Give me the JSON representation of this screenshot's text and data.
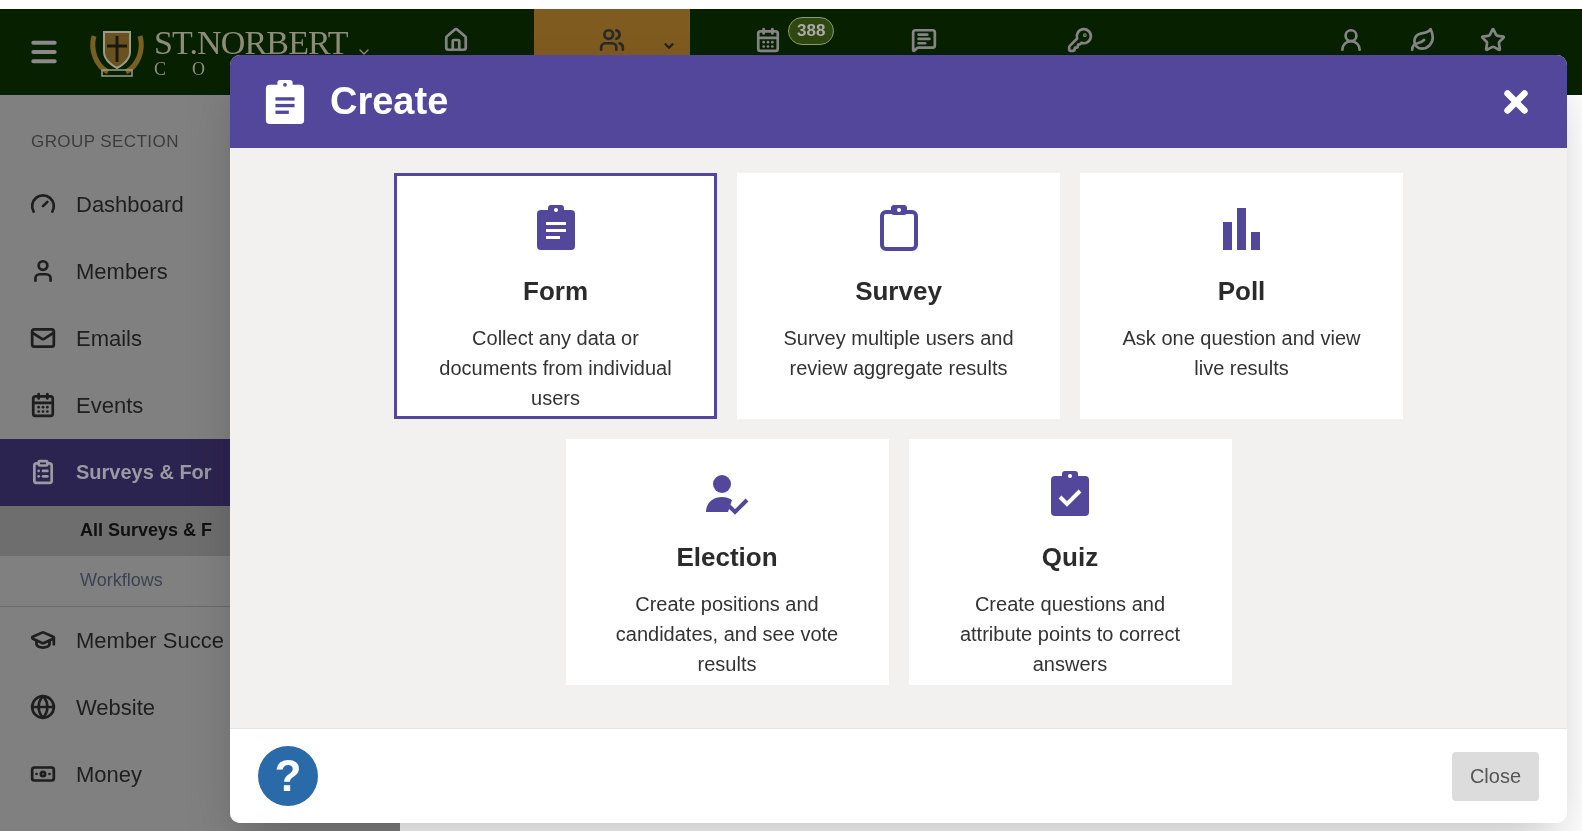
{
  "topbar": {
    "logo": {
      "name": "ST.NORBERT",
      "sub": "C O"
    },
    "items": [
      {
        "kind": "home",
        "selected": false
      },
      {
        "kind": "group",
        "selected": true,
        "dropdown": true
      },
      {
        "kind": "calendar",
        "selected": false,
        "badge": "388"
      },
      {
        "kind": "messages",
        "selected": false
      },
      {
        "kind": "key",
        "selected": false
      },
      {
        "kind": "person",
        "selected": false
      },
      {
        "kind": "leaf",
        "selected": false
      },
      {
        "kind": "star",
        "selected": false
      }
    ]
  },
  "sidebar": {
    "heading": "GROUP SECTION",
    "items": [
      {
        "kind": "dashboard",
        "label": "Dashboard",
        "selected": false
      },
      {
        "kind": "members",
        "label": "Members",
        "selected": false
      },
      {
        "kind": "emails",
        "label": "Emails",
        "selected": false
      },
      {
        "kind": "events",
        "label": "Events",
        "selected": false
      },
      {
        "kind": "surveys",
        "label": "Surveys & For",
        "selected": true,
        "children": [
          {
            "label": "All Surveys & F",
            "selected": true
          },
          {
            "label": "Workflows",
            "selected": false
          }
        ]
      },
      {
        "kind": "success",
        "label": "Member Succe",
        "selected": false
      },
      {
        "kind": "website",
        "label": "Website",
        "selected": false
      },
      {
        "kind": "money",
        "label": "Money",
        "selected": false
      }
    ]
  },
  "modal": {
    "title": "Create",
    "options": [
      {
        "kind": "form",
        "title": "Form",
        "description": "Collect any data or documents from individual users",
        "selected": true
      },
      {
        "kind": "survey",
        "title": "Survey",
        "description": "Survey multiple users and review aggregate results",
        "selected": false
      },
      {
        "kind": "poll",
        "title": "Poll",
        "description": "Ask one question and view live results",
        "selected": false
      },
      {
        "kind": "election",
        "title": "Election",
        "description": "Create positions and candidates, and see vote results",
        "selected": false
      },
      {
        "kind": "quiz",
        "title": "Quiz",
        "description": "Create questions and attribute points to correct answers",
        "selected": false
      }
    ],
    "help": "?",
    "close_button": "Close"
  }
}
